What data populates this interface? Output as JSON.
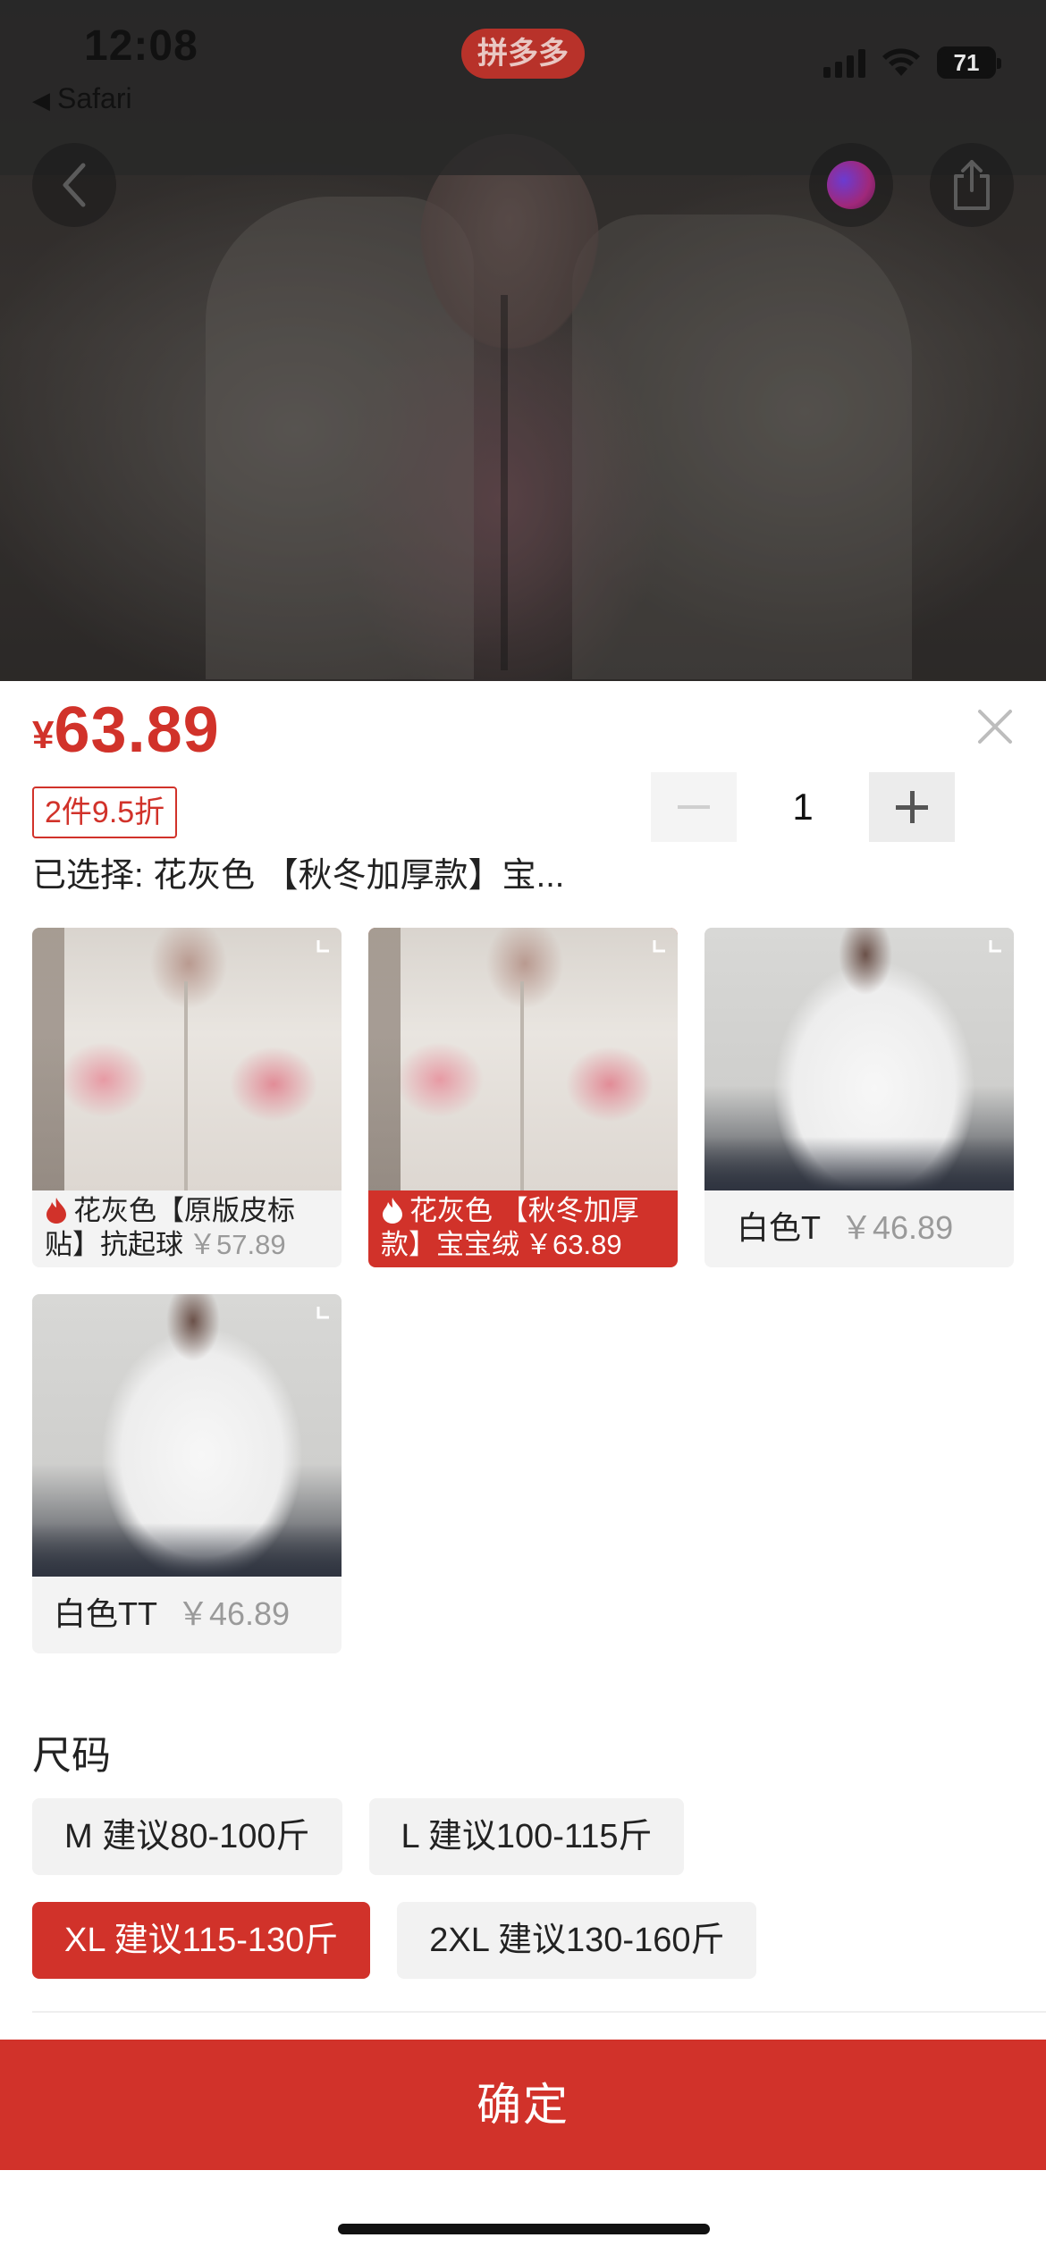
{
  "status_bar": {
    "time": "12:08",
    "back_app": "Safari",
    "app_logo_text": "拼多多",
    "battery": "71"
  },
  "price": {
    "currency": "¥",
    "amount": "63.89"
  },
  "discount_tag": "2件9.5折",
  "quantity": {
    "value": "1",
    "decrement_symbol": "−",
    "increment_symbol": "+"
  },
  "selected_text": "已选择: 花灰色 【秋冬加厚款】宝...",
  "variants": [
    {
      "name": "花灰色【原版皮标贴】抗起球",
      "price": "￥57.89",
      "hot": true,
      "selected": false
    },
    {
      "name": "花灰色 【秋冬加厚款】宝宝绒",
      "price": "￥63.89",
      "hot": true,
      "selected": true
    },
    {
      "name": "白色T",
      "price": "￥46.89",
      "hot": false,
      "selected": false
    },
    {
      "name": "白色TT",
      "price": "￥46.89",
      "hot": false,
      "selected": false
    }
  ],
  "size_section": {
    "title": "尺码",
    "options": [
      {
        "label": "M 建议80-100斤",
        "selected": false
      },
      {
        "label": "L 建议100-115斤",
        "selected": false
      },
      {
        "label": "XL 建议115-130斤",
        "selected": true
      },
      {
        "label": "2XL 建议130-160斤",
        "selected": false
      }
    ]
  },
  "confirm_button": "确定",
  "colors": {
    "accent": "#d1322a",
    "chip_bg": "#f2f2f2"
  },
  "icons": [
    "back-arrow-icon",
    "share-icon",
    "close-icon",
    "flame-icon",
    "expand-icon",
    "signal-icon",
    "wifi-icon",
    "battery-icon"
  ]
}
